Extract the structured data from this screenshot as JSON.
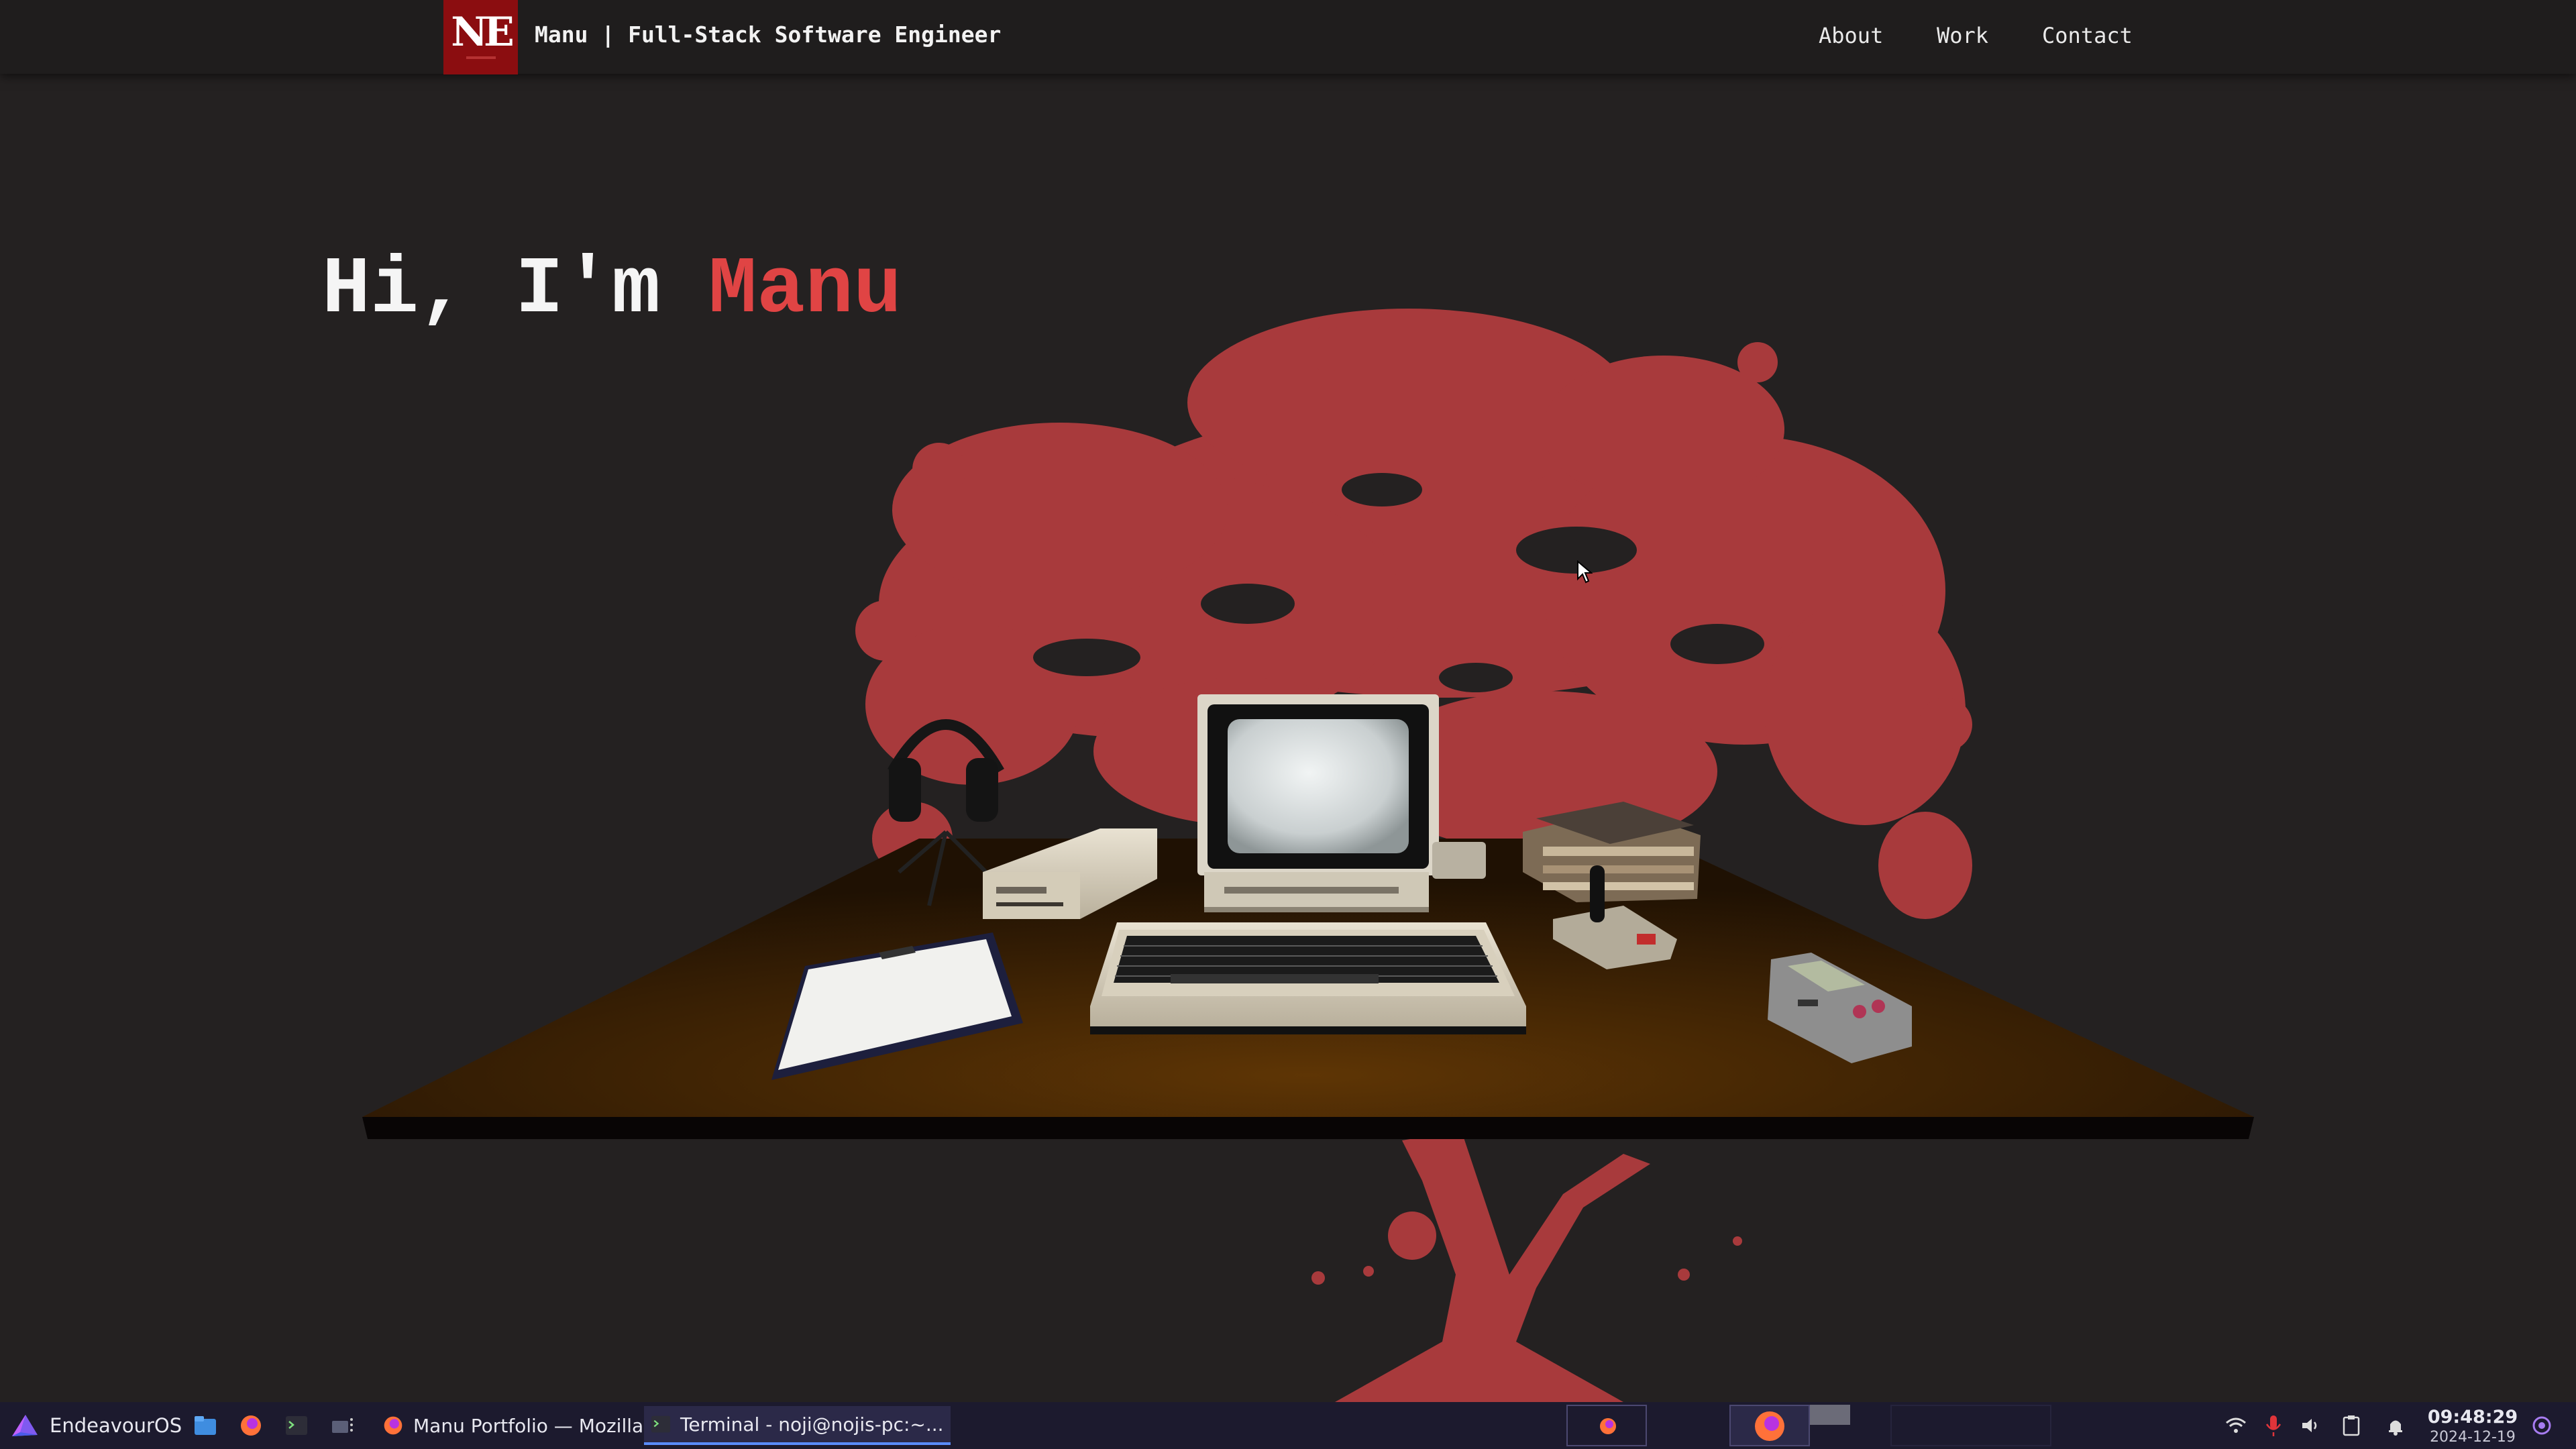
{
  "nav": {
    "logo_text": "NE",
    "title": "Manu | Full-Stack Software Engineer",
    "links": [
      "About",
      "Work",
      "Contact"
    ]
  },
  "hero": {
    "greeting": "Hi, I'm ",
    "name": "Manu"
  },
  "colors": {
    "accent": "#e04444",
    "tree": "#a83a3c",
    "logo_bg": "#8b0d10",
    "page_bg": "#242121",
    "taskbar_bg": "#1c1a2e"
  },
  "scene": {
    "objects": [
      "tree-silhouette",
      "desk",
      "crt-monitor",
      "keyboard",
      "floppy-drive",
      "headphones",
      "joystick",
      "book-stack",
      "clipboard-paper",
      "handheld-game-console"
    ]
  },
  "taskbar": {
    "start_label": "EndeavourOS",
    "launchers": [
      "file-manager-icon",
      "firefox-icon",
      "terminal-icon",
      "overflow-icon"
    ],
    "tasks": [
      {
        "label": "Manu Portfolio — Mozilla ...",
        "icon": "firefox-icon",
        "active": false
      },
      {
        "label": "Terminal - noji@nojis-pc:~...",
        "icon": "terminal-icon",
        "active": true
      }
    ],
    "tray": [
      "wifi-icon",
      "microphone-icon",
      "volume-icon",
      "clipboard-icon",
      "notification-icon"
    ],
    "clock": {
      "time": "09:48:29",
      "date": "2024-12-19"
    }
  }
}
